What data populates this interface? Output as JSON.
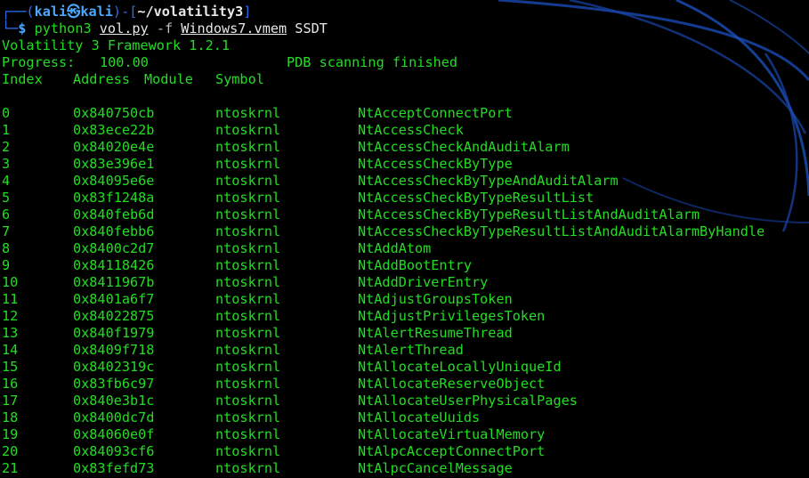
{
  "prompt": {
    "user": "kali",
    "skull": "㉿",
    "host": "kali",
    "path": "~/volatility3",
    "dollar": "$",
    "cmd": "python3",
    "script": "vol.py",
    "flag": "-f",
    "file": "Windows7.vmem",
    "plugin": "SSDT"
  },
  "output": {
    "framework": "Volatility 3 Framework 1.2.1",
    "progress_label": "Progress:",
    "progress_value": "100.00",
    "progress_status": "PDB scanning finished"
  },
  "table": {
    "headers": [
      "Index",
      "Address",
      "Module",
      "Symbol"
    ],
    "rows": [
      [
        "0",
        "0x840750cb",
        "ntoskrnl",
        "NtAcceptConnectPort"
      ],
      [
        "1",
        "0x83ece22b",
        "ntoskrnl",
        "NtAccessCheck"
      ],
      [
        "2",
        "0x84020e4e",
        "ntoskrnl",
        "NtAccessCheckAndAuditAlarm"
      ],
      [
        "3",
        "0x83e396e1",
        "ntoskrnl",
        "NtAccessCheckByType"
      ],
      [
        "4",
        "0x84095e6e",
        "ntoskrnl",
        "NtAccessCheckByTypeAndAuditAlarm"
      ],
      [
        "5",
        "0x83f1248a",
        "ntoskrnl",
        "NtAccessCheckByTypeResultList"
      ],
      [
        "6",
        "0x840feb6d",
        "ntoskrnl",
        "NtAccessCheckByTypeResultListAndAuditAlarm"
      ],
      [
        "7",
        "0x840febb6",
        "ntoskrnl",
        "NtAccessCheckByTypeResultListAndAuditAlarmByHandle"
      ],
      [
        "8",
        "0x8400c2d7",
        "ntoskrnl",
        "NtAddAtom"
      ],
      [
        "9",
        "0x84118426",
        "ntoskrnl",
        "NtAddBootEntry"
      ],
      [
        "10",
        "0x8411967b",
        "ntoskrnl",
        "NtAddDriverEntry"
      ],
      [
        "11",
        "0x8401a6f7",
        "ntoskrnl",
        "NtAdjustGroupsToken"
      ],
      [
        "12",
        "0x84022875",
        "ntoskrnl",
        "NtAdjustPrivilegesToken"
      ],
      [
        "13",
        "0x840f1979",
        "ntoskrnl",
        "NtAlertResumeThread"
      ],
      [
        "14",
        "0x8409f718",
        "ntoskrnl",
        "NtAlertThread"
      ],
      [
        "15",
        "0x8402319c",
        "ntoskrnl",
        "NtAllocateLocallyUniqueId"
      ],
      [
        "16",
        "0x83fb6c97",
        "ntoskrnl",
        "NtAllocateReserveObject"
      ],
      [
        "17",
        "0x840e3b1c",
        "ntoskrnl",
        "NtAllocateUserPhysicalPages"
      ],
      [
        "18",
        "0x8400dc7d",
        "ntoskrnl",
        "NtAllocateUuids"
      ],
      [
        "19",
        "0x84060e0f",
        "ntoskrnl",
        "NtAllocateVirtualMemory"
      ],
      [
        "20",
        "0x84093cf6",
        "ntoskrnl",
        "NtAlpcAcceptConnectPort"
      ],
      [
        "21",
        "0x83fefd73",
        "ntoskrnl",
        "NtAlpcCancelMessage"
      ]
    ]
  },
  "colors": {
    "background": "#000000",
    "text": "#22dd22",
    "prompt_box": "#2b6cf0",
    "wallpaper_swirl": "#1a4fb8"
  }
}
